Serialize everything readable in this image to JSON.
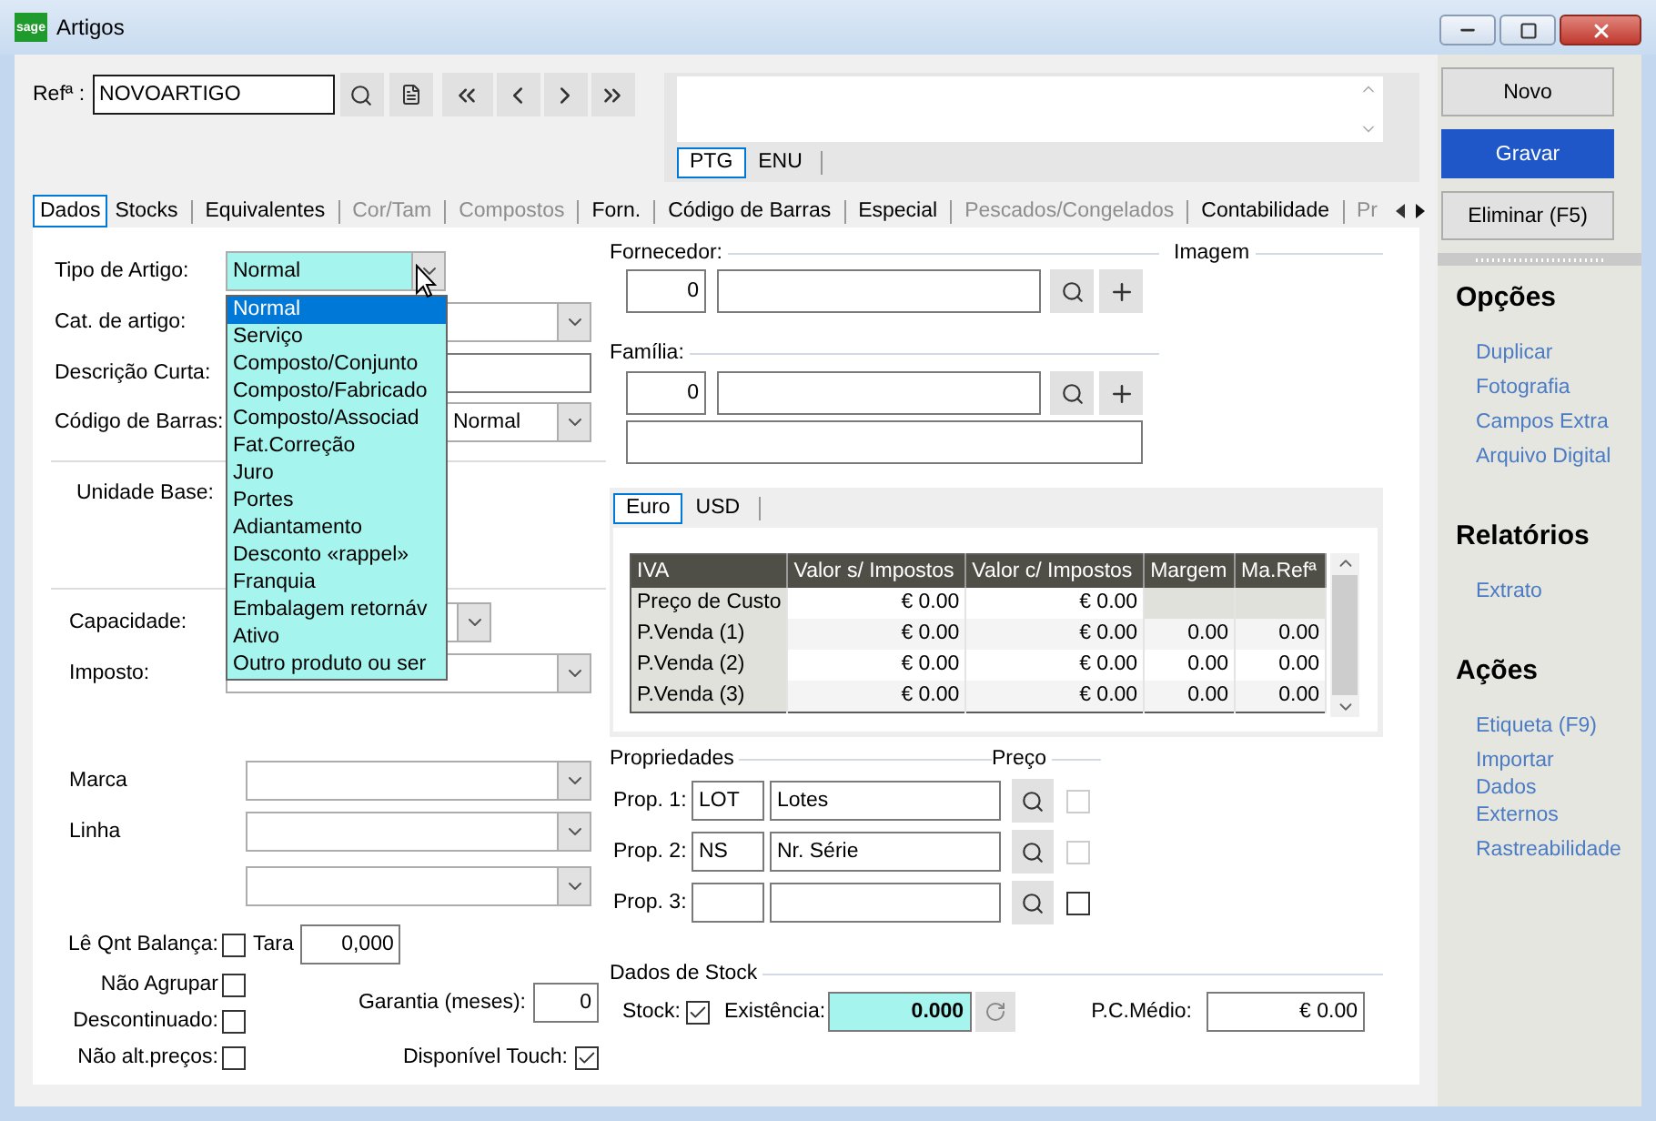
{
  "window": {
    "logo": "sage",
    "title": "Artigos"
  },
  "header": {
    "ref_label": "Refª :",
    "ref_value": "NOVOARTIGO",
    "language_tabs": [
      {
        "label": "PTG",
        "selected": true
      },
      {
        "label": "ENU",
        "selected": false
      }
    ]
  },
  "tabs": [
    {
      "label": "Dados",
      "selected": true,
      "disabled": false
    },
    {
      "label": "Stocks",
      "selected": false,
      "disabled": false
    },
    {
      "label": "Equivalentes",
      "selected": false,
      "disabled": false
    },
    {
      "label": "Cor/Tam",
      "selected": false,
      "disabled": true
    },
    {
      "label": "Compostos",
      "selected": false,
      "disabled": true
    },
    {
      "label": "Forn.",
      "selected": false,
      "disabled": false
    },
    {
      "label": "Código de Barras",
      "selected": false,
      "disabled": false
    },
    {
      "label": "Especial",
      "selected": false,
      "disabled": false
    },
    {
      "label": "Pescados/Congelados",
      "selected": false,
      "disabled": true
    },
    {
      "label": "Contabilidade",
      "selected": false,
      "disabled": false
    },
    {
      "label": "Pr",
      "selected": false,
      "disabled": true
    }
  ],
  "left_form": {
    "tipo_artigo": {
      "label": "Tipo de Artigo:",
      "value": "Normal",
      "options": [
        {
          "label": "Normal",
          "selected": true
        },
        {
          "label": "Serviço",
          "selected": false
        },
        {
          "label": "Composto/Conjunto",
          "selected": false
        },
        {
          "label": "Composto/Fabricado",
          "selected": false
        },
        {
          "label": "Composto/Associad",
          "selected": false
        },
        {
          "label": "Fat.Correção",
          "selected": false
        },
        {
          "label": "Juro",
          "selected": false
        },
        {
          "label": "Portes",
          "selected": false
        },
        {
          "label": "Adiantamento",
          "selected": false
        },
        {
          "label": "Desconto «rappel»",
          "selected": false
        },
        {
          "label": "Franquia",
          "selected": false
        },
        {
          "label": "Embalagem retornáv",
          "selected": false
        },
        {
          "label": "Ativo",
          "selected": false
        },
        {
          "label": "Outro produto ou ser",
          "selected": false
        }
      ]
    },
    "cat_artigo": {
      "label": "Cat. de artigo:"
    },
    "descricao_curta": {
      "label": "Descrição Curta:"
    },
    "codigo_barras": {
      "label": "Código de Barras:",
      "value": "Normal"
    },
    "unidade_base": {
      "label": "Unidade Base:"
    },
    "capacidade": {
      "label": "Capacidade:"
    },
    "imposto": {
      "label": "Imposto:"
    },
    "marca": {
      "label": "Marca"
    },
    "linha": {
      "label": "Linha"
    },
    "le_qnt_balanca": {
      "label": "Lê Qnt Balança:",
      "checked": false
    },
    "tara": {
      "label": "Tara",
      "value": "0,000"
    },
    "nao_agrupar": {
      "label": "Não Agrupar",
      "checked": false
    },
    "garantia": {
      "label": "Garantia (meses):",
      "value": "0"
    },
    "descontinuado": {
      "label": "Descontinuado:",
      "checked": false
    },
    "nao_alt_precos": {
      "label": "Não alt.preços:",
      "checked": false
    },
    "disponivel_touch": {
      "label": "Disponível Touch:",
      "checked": true
    }
  },
  "fornecedor": {
    "heading": "Fornecedor:",
    "code": "0"
  },
  "imagem": {
    "heading": "Imagem"
  },
  "familia": {
    "heading": "Família:",
    "code": "0"
  },
  "prices": {
    "currency_tabs": [
      {
        "label": "Euro",
        "selected": true
      },
      {
        "label": "USD",
        "selected": false
      }
    ],
    "columns": [
      "IVA",
      "Valor s/ Impostos",
      "Valor c/ Impostos",
      "Margem",
      "Ma.Refª"
    ],
    "rows": [
      {
        "label": "Preço de Custo",
        "values": [
          "€ 0.00",
          "€ 0.00"
        ]
      },
      {
        "label": "P.Venda (1)",
        "values": [
          "€ 0.00",
          "€ 0.00",
          "0.00",
          "0.00"
        ]
      },
      {
        "label": "P.Venda (2)",
        "values": [
          "€ 0.00",
          "€ 0.00",
          "0.00",
          "0.00"
        ]
      },
      {
        "label": "P.Venda (3)",
        "values": [
          "€ 0.00",
          "€ 0.00",
          "0.00",
          "0.00"
        ]
      }
    ]
  },
  "properties": {
    "heading": "Propriedades",
    "price_heading": "Preço",
    "rows": [
      {
        "label": "Prop. 1:",
        "code": "LOT",
        "description": "Lotes",
        "price_checked": false,
        "disabled": true
      },
      {
        "label": "Prop. 2:",
        "code": "NS",
        "description": "Nr. Série",
        "price_checked": false,
        "disabled": true
      },
      {
        "label": "Prop. 3:",
        "price_checked": false,
        "disabled": false
      }
    ]
  },
  "stock": {
    "heading": "Dados de Stock",
    "stock_label": "Stock:",
    "stock_checked": true,
    "existencia_label": "Existência:",
    "existencia_value": "0.000",
    "pcm_label": "P.C.Médio:",
    "pcm_value": "€ 0.00"
  },
  "actions": [
    {
      "label": "Novo",
      "primary": false
    },
    {
      "label": "Gravar",
      "primary": true
    },
    {
      "label": "Eliminar (F5)",
      "primary": false
    }
  ],
  "sections": [
    {
      "heading": "Opções",
      "links": [
        "Duplicar",
        "Fotografia",
        "Campos Extra",
        "Arquivo Digital"
      ]
    },
    {
      "heading": "Relatórios",
      "links": [
        "Extrato"
      ]
    },
    {
      "heading": "Ações",
      "links": [
        "Etiqueta (F9)",
        "Importar Dados Externos",
        "Rastreabilidade"
      ]
    }
  ]
}
